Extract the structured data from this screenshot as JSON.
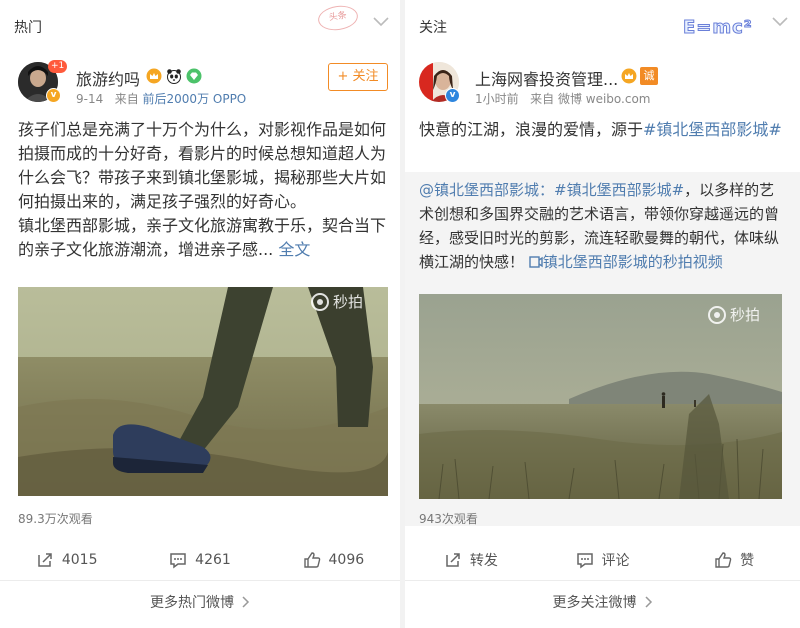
{
  "left": {
    "section_title": "热门",
    "stamp_text": "头条",
    "author": {
      "name": "旅游约吗",
      "avatar_badge": "+1",
      "date": "9-14",
      "source_prefix": "来自",
      "source": "前后2000万 OPPO"
    },
    "follow_label": "+ 关注",
    "text": "孩子们总是充满了十万个为什么，对影视作品是如何拍摄而成的十分好奇，看影片的时候总想知道超人为什么会飞？带孩子来到镇北堡影城，揭秘那些大片如何拍摄出来的，满足孩子强烈的好奇心。",
    "text2": "镇北堡西部影城，亲子文化旅游寓教于乐，契合当下的亲子文化旅游潮流，增进亲子感...",
    "more_link": "全文",
    "watermark": "秒拍",
    "views": "89.3万次观看",
    "actions": {
      "repost": "4015",
      "comment": "4261",
      "like": "4096"
    },
    "more_bar": "更多热门微博"
  },
  "right": {
    "section_title": "关注",
    "logo_text": "E=mc²",
    "author": {
      "name": "上海网睿投资管理...",
      "time": "1小时前",
      "source_prefix": "来自",
      "source": "微博 weibo.com",
      "level_badge": "诚"
    },
    "text_plain": "快意的江湖，浪漫的爱情，源于",
    "text_tag": "#镇北堡西部影城#",
    "repost": {
      "author_link": "@镇北堡西部影城",
      "sep": "：",
      "tag": "#镇北堡西部影城#",
      "text": "，以多样的艺术创想和多国界交融的艺术语言，带领你穿越遥远的曾经，感受旧时光的剪影，流连轻歌曼舞的朝代，体味纵横江湖的快感！",
      "video_link": "镇北堡西部影城的秒拍视频"
    },
    "watermark": "秒拍",
    "views": "943次观看",
    "actions": {
      "repost": "转发",
      "comment": "评论",
      "like": "赞"
    },
    "more_bar": "更多关注微博"
  },
  "colors": {
    "accent_orange": "#f28b25",
    "link_blue": "#507daf",
    "verified_orange": "#f5a623",
    "verified_blue": "#2e86de"
  }
}
